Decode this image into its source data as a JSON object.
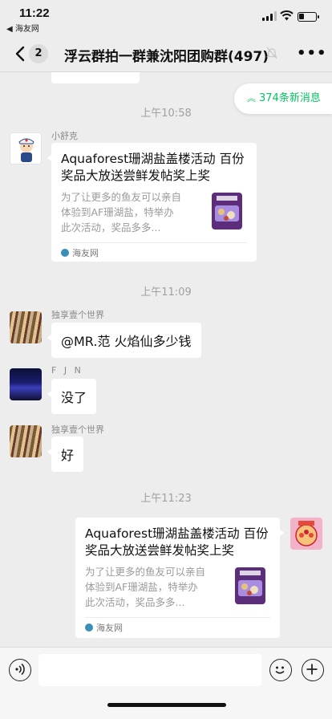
{
  "status_bar": {
    "time": "11:22",
    "back_app": "◀ 海友网",
    "battery_level": 0.3
  },
  "nav": {
    "back_count": "2",
    "title": "浮云群拍一群兼沈阳团购群(497)"
  },
  "new_messages": {
    "label": "374条新消息"
  },
  "messages": [
    {
      "type": "time",
      "text": "上午10:58"
    },
    {
      "type": "card",
      "sender": "小舒克",
      "title": "Aquaforest珊湖盐盖楼活动 百份奖品大放送尝鲜发帖奖上奖",
      "desc": "为了让更多的鱼友可以亲自体验到AF珊湖盐，特举办此次活动，奖品多多...",
      "source": "海友网"
    },
    {
      "type": "time",
      "text": "上午11:09"
    },
    {
      "type": "text",
      "sender": "独享壹个世界",
      "text": "@MR.范 火焰仙多少钱"
    },
    {
      "type": "text",
      "sender": "F J N",
      "text": "没了"
    },
    {
      "type": "text",
      "sender": "独享壹个世界",
      "text": "好"
    },
    {
      "type": "time",
      "text": "上午11:23"
    },
    {
      "type": "card-self",
      "title": "Aquaforest珊湖盐盖楼活动 百份奖品大放送尝鲜发帖奖上奖",
      "desc": "为了让更多的鱼友可以亲自体验到AF珊湖盐，特举办此次活动，奖品多多...",
      "source": "海友网"
    }
  ],
  "colors": {
    "background": "#ededed",
    "accent_green": "#07c160",
    "bubble": "#ffffff"
  },
  "icons": [
    "back-chevron-icon",
    "mute-bell-icon",
    "more-icon",
    "voice-icon",
    "emoji-icon",
    "plus-icon"
  ]
}
